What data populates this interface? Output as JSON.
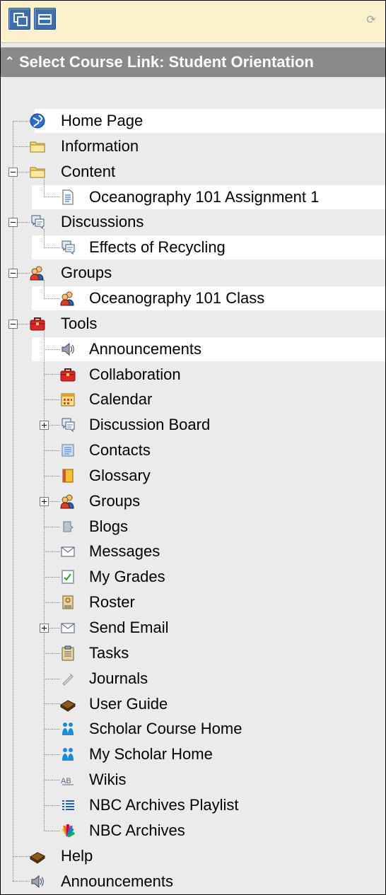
{
  "header": {
    "title": "Select Course Link: Student Orientation"
  },
  "tree": [
    {
      "id": "home-page",
      "label": "Home Page",
      "level": 0,
      "icon": "globe-icon",
      "highlight": true
    },
    {
      "id": "information",
      "label": "Information",
      "level": 0,
      "icon": "folder-icon"
    },
    {
      "id": "content",
      "label": "Content",
      "level": 0,
      "icon": "folder-icon",
      "toggle": "minus"
    },
    {
      "id": "oceanography-assignment",
      "label": "Oceanography 101 Assignment 1",
      "level": 1,
      "icon": "document-icon",
      "highlight": true
    },
    {
      "id": "discussions",
      "label": "Discussions",
      "level": 0,
      "icon": "discussion-icon",
      "toggle": "minus"
    },
    {
      "id": "effects-of-recycling",
      "label": "Effects of Recycling",
      "level": 1,
      "icon": "discussion-icon",
      "highlight": true
    },
    {
      "id": "groups",
      "label": "Groups",
      "level": 0,
      "icon": "group-icon",
      "toggle": "minus"
    },
    {
      "id": "oceanography-class",
      "label": "Oceanography 101 Class",
      "level": 1,
      "icon": "group-icon",
      "highlight": true
    },
    {
      "id": "tools",
      "label": "Tools",
      "level": 0,
      "icon": "toolbox-icon",
      "toggle": "minus"
    },
    {
      "id": "tools-announcements",
      "label": "Announcements",
      "level": 1,
      "icon": "speaker-icon",
      "highlight": true
    },
    {
      "id": "collaboration",
      "label": "Collaboration",
      "level": 1,
      "icon": "toolbox-icon"
    },
    {
      "id": "calendar",
      "label": "Calendar",
      "level": 1,
      "icon": "calendar-icon"
    },
    {
      "id": "discussion-board",
      "label": "Discussion Board",
      "level": 1,
      "icon": "discussion-icon",
      "toggle": "plus"
    },
    {
      "id": "contacts",
      "label": "Contacts",
      "level": 1,
      "icon": "contacts-icon"
    },
    {
      "id": "glossary",
      "label": "Glossary",
      "level": 1,
      "icon": "glossary-icon"
    },
    {
      "id": "tools-groups",
      "label": "Groups",
      "level": 1,
      "icon": "group-icon",
      "toggle": "plus"
    },
    {
      "id": "blogs",
      "label": "Blogs",
      "level": 1,
      "icon": "blog-icon"
    },
    {
      "id": "messages",
      "label": "Messages",
      "level": 1,
      "icon": "envelope-icon"
    },
    {
      "id": "my-grades",
      "label": "My Grades",
      "level": 1,
      "icon": "grades-icon"
    },
    {
      "id": "roster",
      "label": "Roster",
      "level": 1,
      "icon": "roster-icon"
    },
    {
      "id": "send-email",
      "label": "Send Email",
      "level": 1,
      "icon": "envelope-icon",
      "toggle": "plus"
    },
    {
      "id": "tasks",
      "label": "Tasks",
      "level": 1,
      "icon": "clipboard-icon"
    },
    {
      "id": "journals",
      "label": "Journals",
      "level": 1,
      "icon": "journal-icon"
    },
    {
      "id": "user-guide",
      "label": "User Guide",
      "level": 1,
      "icon": "book-icon"
    },
    {
      "id": "scholar-course-home",
      "label": "Scholar Course Home",
      "level": 1,
      "icon": "scholar-icon"
    },
    {
      "id": "my-scholar-home",
      "label": "My Scholar Home",
      "level": 1,
      "icon": "scholar-icon"
    },
    {
      "id": "wikis",
      "label": "Wikis",
      "level": 1,
      "icon": "wiki-icon"
    },
    {
      "id": "nbc-archives-playlist",
      "label": "NBC Archives Playlist",
      "level": 1,
      "icon": "playlist-icon"
    },
    {
      "id": "nbc-archives",
      "label": "NBC Archives",
      "level": 1,
      "icon": "peacock-icon"
    },
    {
      "id": "help",
      "label": "Help",
      "level": 0,
      "icon": "book-icon"
    },
    {
      "id": "announcements",
      "label": "Announcements",
      "level": 0,
      "icon": "speaker-icon"
    }
  ]
}
